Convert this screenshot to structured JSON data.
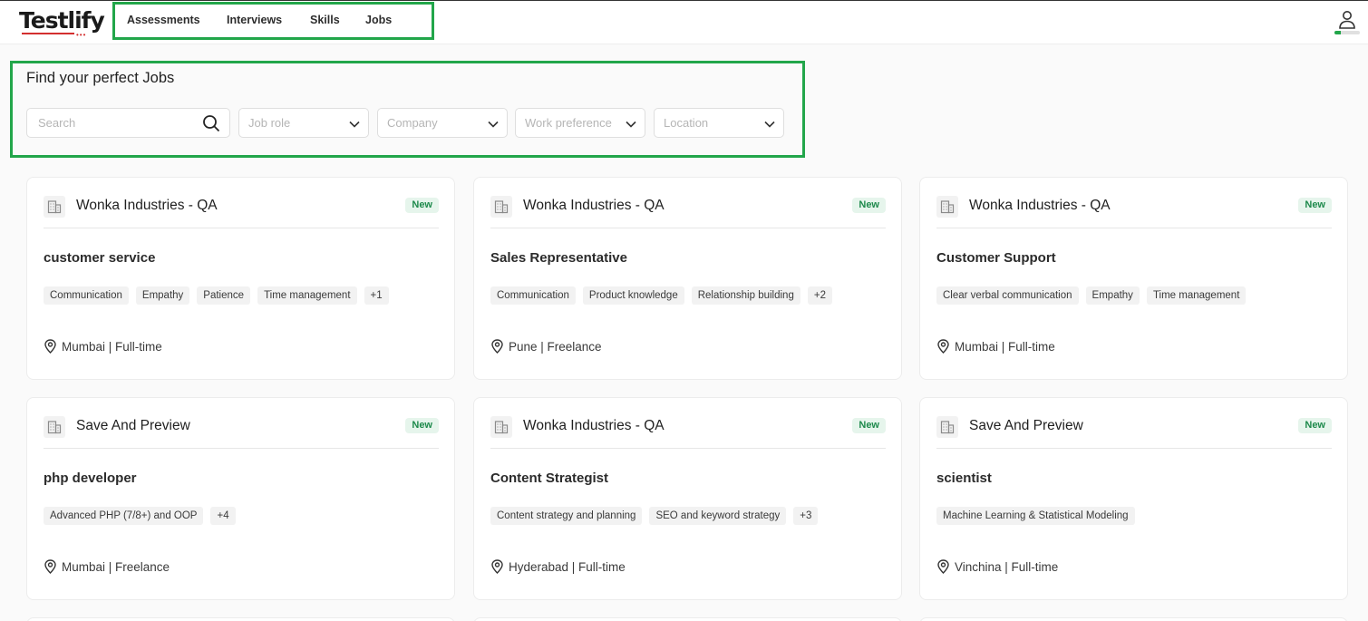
{
  "brand": {
    "name": "Testlify",
    "accent": "#d32f2f",
    "highlight": "#22a64a"
  },
  "nav": {
    "items": [
      {
        "label": "Assessments"
      },
      {
        "label": "Interviews"
      },
      {
        "label": "Skills"
      },
      {
        "label": "Jobs"
      }
    ]
  },
  "user": {
    "icon": "user-icon",
    "progress": 0.25
  },
  "filters": {
    "title": "Find your perfect Jobs",
    "search_placeholder": "Search",
    "dropdowns": [
      {
        "label": "Job role"
      },
      {
        "label": "Company"
      },
      {
        "label": "Work preference"
      },
      {
        "label": "Location"
      }
    ]
  },
  "jobs": [
    {
      "company": "Wonka Industries - QA",
      "badge": "New",
      "title": "customer service",
      "skills": [
        "Communication",
        "Empathy",
        "Patience",
        "Time management",
        "+1"
      ],
      "location": "Mumbai | Full-time"
    },
    {
      "company": "Wonka Industries - QA",
      "badge": "New",
      "title": "Sales Representative",
      "skills": [
        "Communication",
        "Product knowledge",
        "Relationship building",
        "+2"
      ],
      "location": "Pune | Freelance"
    },
    {
      "company": "Wonka Industries - QA",
      "badge": "New",
      "title": "Customer Support",
      "skills": [
        "Clear verbal communication",
        "Empathy",
        "Time management"
      ],
      "location": "Mumbai | Full-time"
    },
    {
      "company": "Save And Preview",
      "badge": "New",
      "title": "php developer",
      "skills": [
        "Advanced PHP (7/8+) and OOP",
        "+4"
      ],
      "location": "Mumbai | Freelance"
    },
    {
      "company": "Wonka Industries - QA",
      "badge": "New",
      "title": "Content Strategist",
      "skills": [
        "Content strategy and planning",
        "SEO and keyword strategy",
        "+3"
      ],
      "location": "Hyderabad | Full-time"
    },
    {
      "company": "Save And Preview",
      "badge": "New",
      "title": "scientist",
      "skills": [
        "Machine Learning & Statistical Modeling"
      ],
      "location": "Vinchina | Full-time"
    }
  ]
}
